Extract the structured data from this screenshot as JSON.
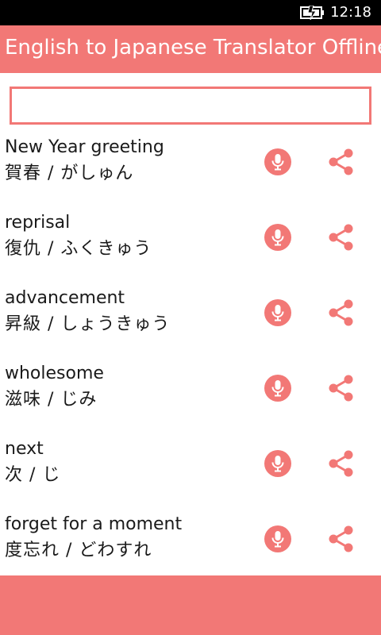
{
  "status": {
    "time": "12:18",
    "battery_icon": "battery-charging-icon"
  },
  "app": {
    "title": "English to Japanese Translator Offline"
  },
  "search": {
    "value": "",
    "placeholder": ""
  },
  "colors": {
    "accent": "#f27876",
    "status_bar": "#000000",
    "background": "#ffffff"
  },
  "entries": [
    {
      "english": "New Year greeting",
      "japanese": "賀春 / がしゅん"
    },
    {
      "english": "reprisal",
      "japanese": "復仇 / ふくきゅう"
    },
    {
      "english": "advancement",
      "japanese": "昇級 / しょうきゅう"
    },
    {
      "english": "wholesome",
      "japanese": "滋味 / じみ"
    },
    {
      "english": "next",
      "japanese": "次 / じ"
    },
    {
      "english": "forget for a moment",
      "japanese": "度忘れ / どわすれ"
    }
  ],
  "icons": {
    "speak": "microphone-icon",
    "share": "share-icon"
  }
}
